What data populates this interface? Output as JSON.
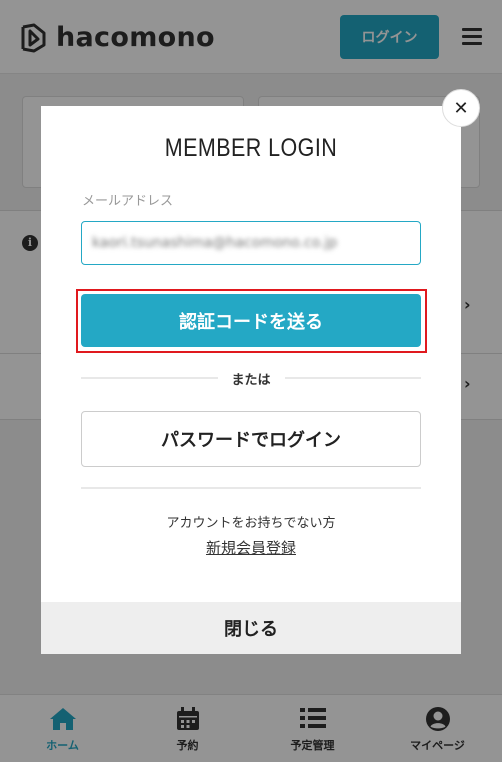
{
  "header": {
    "logo_text": "hacomono",
    "login_label": "ログイン"
  },
  "tabbar": {
    "items": [
      {
        "label": "ホーム",
        "icon": "home-icon"
      },
      {
        "label": "予約",
        "icon": "calendar-icon"
      },
      {
        "label": "予定管理",
        "icon": "list-icon"
      },
      {
        "label": "マイページ",
        "icon": "user-icon"
      }
    ]
  },
  "modal": {
    "title": "MEMBER LOGIN",
    "email_label": "メールアドレス",
    "email_value": "kaori.tsunashima@hacomono.co.jp",
    "send_code_label": "認証コードを送る",
    "or_label": "または",
    "password_login_label": "パスワードでログイン",
    "no_account_text": "アカウントをお持ちでない方",
    "register_label": "新規会員登録",
    "close_label": "閉じる"
  },
  "colors": {
    "accent": "#24a8c5",
    "highlight": "#e0191e"
  }
}
